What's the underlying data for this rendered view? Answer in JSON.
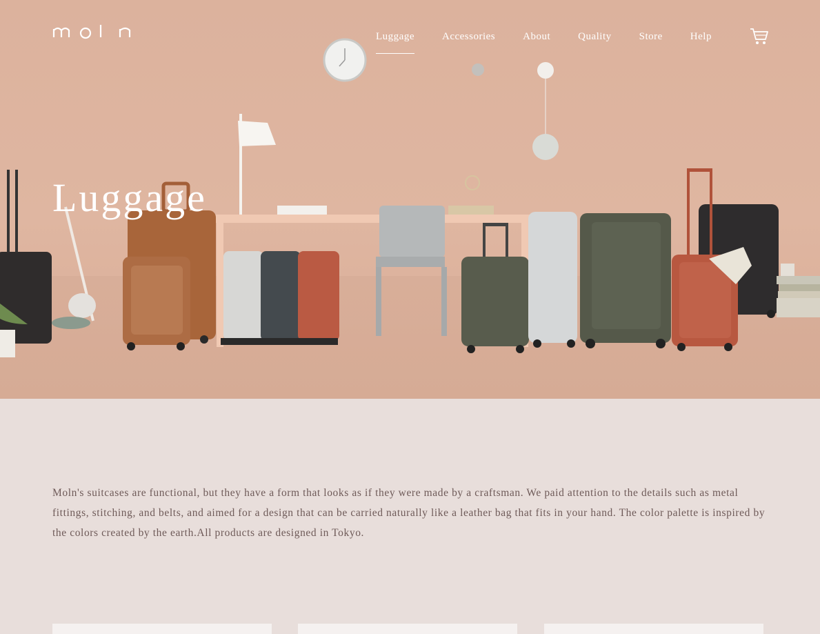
{
  "header": {
    "logo_text": "moln",
    "nav": [
      "Luggage",
      "Accessories",
      "About",
      "Quality",
      "Store",
      "Help"
    ],
    "active_nav": "Luggage",
    "cart_icon": "cart-icon"
  },
  "hero": {
    "title": "Luggage"
  },
  "intro": {
    "text": "Moln's suitcases are functional, but they have a form that looks as if they were made by a craftsman. We paid attention to the details such as metal fittings, stitching, and belts, and aimed for a design that can be carried naturally like a leather bag that fits in your hand. The color palette is inspired by the colors created by the earth.All products are designed in Tokyo."
  },
  "colors": {
    "hero_bg": "#dcb29d",
    "page_bg": "#e8dedb",
    "text": "#6e5a58",
    "card_bg": "#f5f1f0"
  }
}
